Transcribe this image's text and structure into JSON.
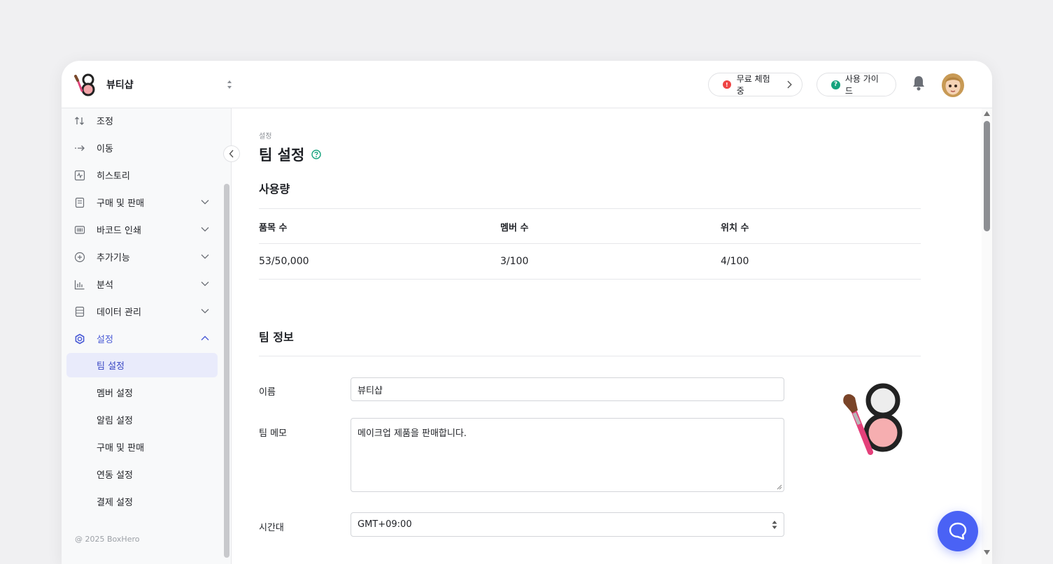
{
  "header": {
    "team_name": "뷰티샵",
    "trial": {
      "badge": "!",
      "label": "무료 체험 중"
    },
    "guide": {
      "badge": "?",
      "label": "사용 가이드"
    }
  },
  "sidebar": {
    "items": [
      {
        "label": "조정",
        "icon": "adjust-arrows-icon"
      },
      {
        "label": "이동",
        "icon": "move-arrow-icon"
      },
      {
        "label": "히스토리",
        "icon": "history-icon"
      },
      {
        "label": "구매 및 판매",
        "icon": "document-icon",
        "expandable": true
      },
      {
        "label": "바코드 인쇄",
        "icon": "barcode-icon",
        "expandable": true
      },
      {
        "label": "추가기능",
        "icon": "plus-circle-icon",
        "expandable": true
      },
      {
        "label": "분석",
        "icon": "bar-chart-icon",
        "expandable": true
      },
      {
        "label": "데이터 관리",
        "icon": "database-icon",
        "expandable": true
      },
      {
        "label": "설정",
        "icon": "gear-icon",
        "expandable": true,
        "expanded": true
      }
    ],
    "sub_items": [
      {
        "label": "팀 설정",
        "selected": true
      },
      {
        "label": "멤버 설정"
      },
      {
        "label": "알림 설정"
      },
      {
        "label": "구매 및 판매"
      },
      {
        "label": "연동 설정"
      },
      {
        "label": "결제 설정"
      }
    ],
    "copyright": "@ 2025 BoxHero"
  },
  "main": {
    "breadcrumb": "설정",
    "title": "팀 설정",
    "usage": {
      "title": "사용량",
      "columns": [
        {
          "header": "품목 수",
          "value": "53/50,000"
        },
        {
          "header": "멤버 수",
          "value": "3/100"
        },
        {
          "header": "위치 수",
          "value": "4/100"
        }
      ]
    },
    "team_info": {
      "title": "팀 정보",
      "name_label": "이름",
      "name_value": "뷰티샵",
      "memo_label": "팀 메모",
      "memo_value": "메이크업 제품을 판매합니다.",
      "timezone_label": "시간대",
      "timezone_value": "GMT+09:00"
    }
  },
  "colors": {
    "accent": "#4a5bd6",
    "selected_bg": "#e9ebfb",
    "trial_badge": "#ef4444",
    "guide_badge": "#16a37e",
    "chat_button": "#4a62f5"
  }
}
